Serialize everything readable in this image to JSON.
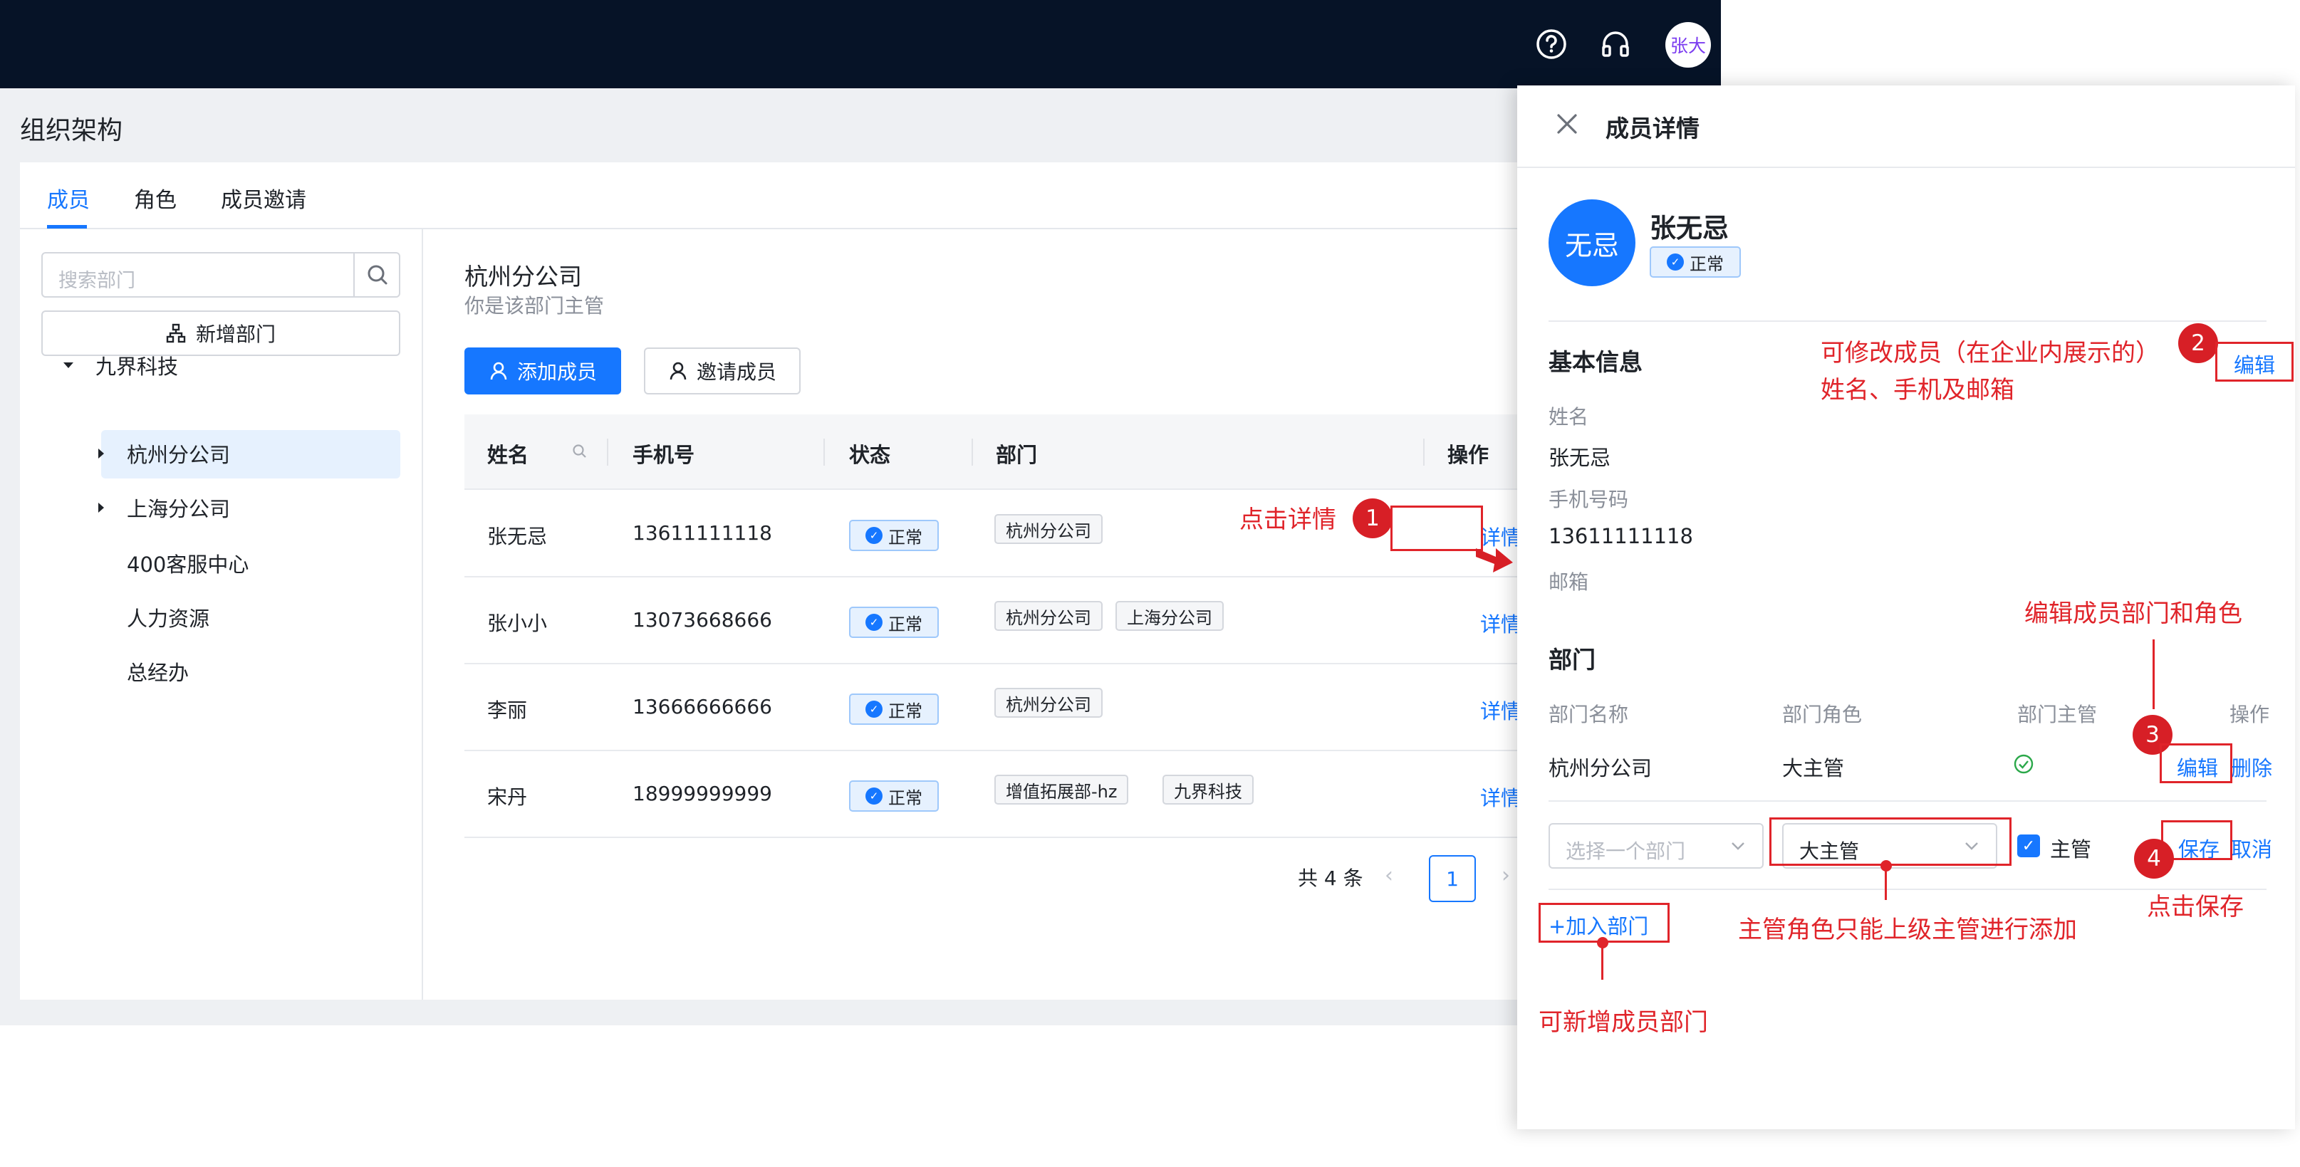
{
  "topbar": {
    "help_icon": "question-circle-icon",
    "support_icon": "headset-icon",
    "user_avatar": "张大"
  },
  "page": {
    "title": "组织架构"
  },
  "tabs": [
    {
      "label": "成员",
      "active": true
    },
    {
      "label": "角色",
      "active": false
    },
    {
      "label": "成员邀请",
      "active": false
    }
  ],
  "sidebar": {
    "search_placeholder": "搜索部门",
    "add_dept_label": "新增部门",
    "tree": [
      {
        "label": "九界科技",
        "level": 0,
        "expanded": true
      },
      {
        "label": "杭州分公司",
        "level": 1,
        "collapsed": true,
        "selected": true
      },
      {
        "label": "上海分公司",
        "level": 1,
        "collapsed": true
      },
      {
        "label": "400客服中心",
        "level": 1
      },
      {
        "label": "人力资源",
        "level": 1
      },
      {
        "label": "总经办",
        "level": 1
      }
    ]
  },
  "main": {
    "dept_title": "杭州分公司",
    "dept_subtitle": "你是该部门主管",
    "add_member_label": "添加成员",
    "invite_member_label": "邀请成员",
    "columns": [
      "姓名",
      "手机号",
      "状态",
      "部门",
      "操作"
    ],
    "rows": [
      {
        "name": "张无忌",
        "phone": "13611111118",
        "status": "正常",
        "depts": [
          "杭州分公司"
        ],
        "action": "详情"
      },
      {
        "name": "张小小",
        "phone": "13073668666",
        "status": "正常",
        "depts": [
          "杭州分公司",
          "上海分公司"
        ],
        "action": "详情"
      },
      {
        "name": "李丽",
        "phone": "13666666666",
        "status": "正常",
        "depts": [
          "杭州分公司"
        ],
        "action": "详情"
      },
      {
        "name": "宋丹",
        "phone": "18999999999",
        "status": "正常",
        "depts": [
          "增值拓展部-hz",
          "九界科技"
        ],
        "action": "详情"
      }
    ],
    "pagination": {
      "total_text": "共 4 条",
      "current_page": "1",
      "prev": "‹",
      "next": "›"
    }
  },
  "drawer": {
    "title": "成员详情",
    "avatar_text": "无忌",
    "name": "张无忌",
    "status": "正常",
    "basic_info": {
      "title": "基本信息",
      "edit_label": "编辑",
      "name_label": "姓名",
      "name_value": "张无忌",
      "phone_label": "手机号码",
      "phone_value": "13611111118",
      "email_label": "邮箱"
    },
    "dept_section": {
      "title": "部门",
      "columns": [
        "部门名称",
        "部门角色",
        "部门主管",
        "操作"
      ],
      "row": {
        "dept": "杭州分公司",
        "role": "大主管",
        "is_manager": true,
        "edit": "编辑",
        "delete": "删除"
      },
      "edit_row": {
        "dept_placeholder": "选择一个部门",
        "role_value": "大主管",
        "manager_checkbox_label": "主管",
        "manager_checked": true,
        "save": "保存",
        "cancel": "取消"
      },
      "add_dept_label": "+加入部门"
    }
  },
  "annotations": {
    "click_detail": "点击详情",
    "basic_line1": "可修改成员（在企业内展示的）",
    "basic_line2": "姓名、手机及邮箱",
    "edit_dept_role": "编辑成员部门和角色",
    "click_save": "点击保存",
    "manager_note": "主管角色只能上级主管进行添加",
    "add_dept_note": "可新增成员部门",
    "numbers": [
      "1",
      "2",
      "3",
      "4"
    ]
  },
  "colors": {
    "accent": "#1677ff",
    "topbar": "#061327",
    "annotation": "#e0242a"
  }
}
